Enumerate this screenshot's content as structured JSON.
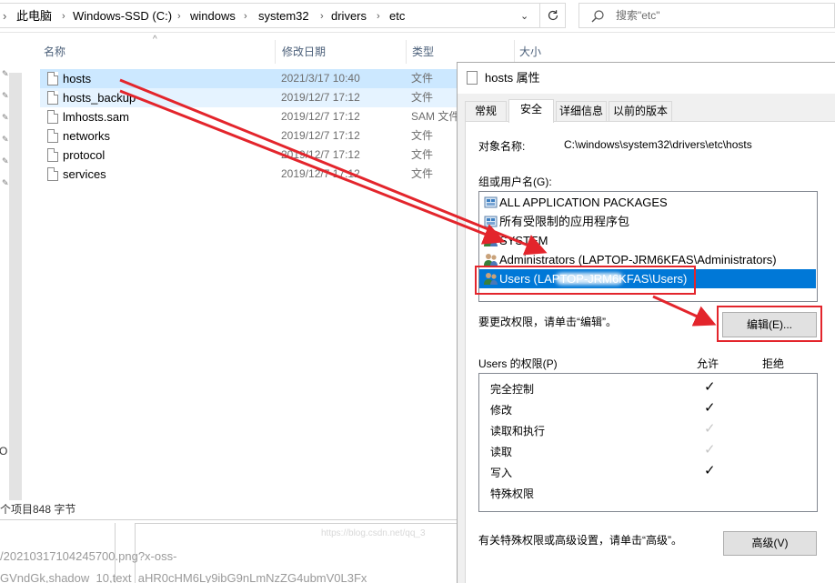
{
  "explorer": {
    "breadcrumb": [
      "此电脑",
      "Windows-SSD (C:)",
      "windows",
      "system32",
      "drivers",
      "etc"
    ],
    "search_placeholder": "搜索\"etc\"",
    "columns": [
      "名称",
      "修改日期",
      "类型",
      "大小"
    ],
    "files": [
      {
        "name": "hosts",
        "date": "2021/3/17 10:40",
        "type": "文件"
      },
      {
        "name": "hosts_backup",
        "date": "2019/12/7 17:12",
        "type": "文件"
      },
      {
        "name": "lmhosts.sam",
        "date": "2019/12/7 17:12",
        "type": "SAM 文件"
      },
      {
        "name": "networks",
        "date": "2019/12/7 17:12",
        "type": "文件"
      },
      {
        "name": "protocol",
        "date": "2019/12/7 17:12",
        "type": "文件"
      },
      {
        "name": "services",
        "date": "2019/12/7 17:12",
        "type": "文件"
      }
    ],
    "status": {
      "items": "个项目",
      "selected_size": "848 字节"
    },
    "left_clip": "O"
  },
  "background": {
    "line1": "/20210317104245700.png?x-oss-",
    "line2": "GVndGk,shadow_10,text_aHR0cHM6Ly9ibG9nLmNzZG4ubmV0L3Fx"
  },
  "dialog": {
    "title": "hosts 属性",
    "tabs": [
      "常规",
      "安全",
      "详细信息",
      "以前的版本"
    ],
    "active_tab": "安全",
    "object_label": "对象名称:",
    "object_path": "C:\\windows\\system32\\drivers\\etc\\hosts",
    "group_label": "组或用户名(G):",
    "groups": [
      {
        "name": "ALL APPLICATION PACKAGES",
        "icon": "package-group-icon"
      },
      {
        "name": "所有受限制的应用程序包",
        "icon": "package-group-icon"
      },
      {
        "name": "SYSTEM",
        "icon": "users-icon"
      },
      {
        "name": "Administrators (LAPTOP-JRM6KFAS\\Administrators)",
        "icon": "users-icon"
      },
      {
        "name": "Users (LAPTOP-JRM6KFAS\\Users)",
        "icon": "users-icon",
        "selected": true
      }
    ],
    "change_hint": "要更改权限，请单击“编辑”。",
    "edit_button": "编辑(E)...",
    "perm_title": "Users 的权限(P)",
    "allow_header": "允许",
    "deny_header": "拒绝",
    "permissions": [
      {
        "name": "完全控制",
        "allow": true,
        "inherited": false
      },
      {
        "name": "修改",
        "allow": true,
        "inherited": false
      },
      {
        "name": "读取和执行",
        "allow": true,
        "inherited": true
      },
      {
        "name": "读取",
        "allow": true,
        "inherited": true
      },
      {
        "name": "写入",
        "allow": true,
        "inherited": false
      },
      {
        "name": "特殊权限",
        "allow": false,
        "inherited": false
      }
    ],
    "advanced_hint": "有关特殊权限或高级设置，请单击“高级”。",
    "advanced_button": "高级(V)",
    "watermark": "https://blog.csdn.net/qq_3"
  },
  "colors": {
    "selection": "#0078d7",
    "row_selected": "#cce8ff",
    "annotation": "#e3252c"
  }
}
